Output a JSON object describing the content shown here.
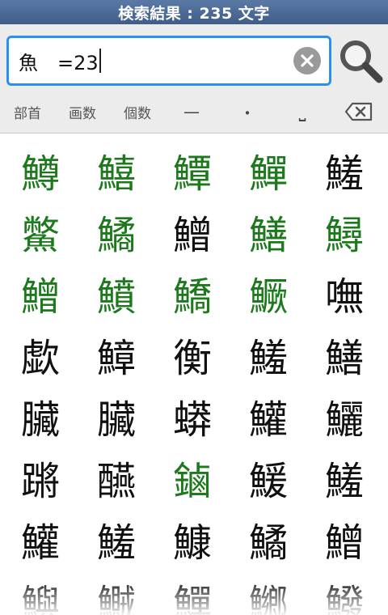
{
  "header": {
    "title": "検索結果 : 235 文字"
  },
  "search": {
    "query": "魚　=23"
  },
  "toolbar": {
    "bushu": "部首",
    "kakusu": "画数",
    "kosu": "個数",
    "dash": "—",
    "dot": "・",
    "space": "⎵"
  },
  "colors": {
    "accent": "#2b8ff0",
    "match": "#1c7a1c",
    "title_bg": "#4a6a98"
  },
  "results": [
    [
      "鱒",
      "鱚",
      "鱏",
      "鱓",
      "鱃"
    ],
    [
      "鱉",
      "鱊",
      "鱛",
      "鱔",
      "鱘"
    ],
    [
      "鱛",
      "鱝",
      "鱎",
      "鱖",
      "嘸"
    ],
    [
      "歔",
      "鱆",
      "衡",
      "鱃",
      "鱔"
    ],
    [
      "臟",
      "臟",
      "蟒",
      "鱹",
      "鱺"
    ],
    [
      "蹡",
      "醼",
      "鏀",
      "鰀",
      "鱃"
    ],
    [
      "鱹",
      "鱃",
      "鱇",
      "鱊",
      "鱛"
    ],
    [
      "鱮",
      "鱡",
      "鱓",
      "鱜",
      "鱍"
    ]
  ],
  "green_flags": [
    [
      true,
      true,
      true,
      true,
      false
    ],
    [
      true,
      true,
      false,
      true,
      true
    ],
    [
      true,
      true,
      true,
      true,
      false
    ],
    [
      false,
      false,
      false,
      false,
      false
    ],
    [
      false,
      false,
      false,
      false,
      false
    ],
    [
      false,
      false,
      true,
      false,
      false
    ],
    [
      false,
      false,
      false,
      false,
      false
    ],
    [
      false,
      false,
      false,
      false,
      false
    ]
  ]
}
